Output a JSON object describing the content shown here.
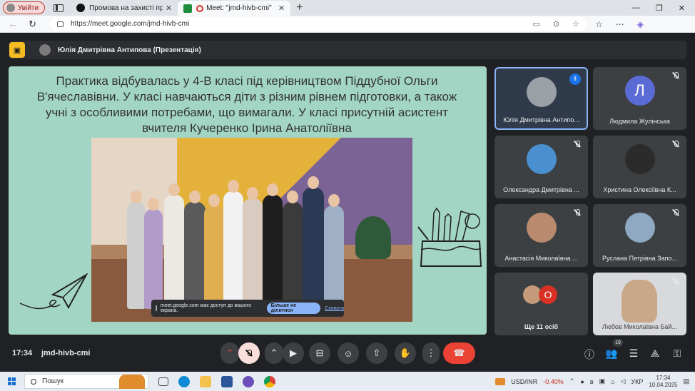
{
  "browser": {
    "profile_label": "Увійти",
    "tabs": [
      {
        "title": "Промова на захисті практики"
      },
      {
        "title": "Meet: \"jmd-hivb-cmi\""
      }
    ],
    "url": "https://meet.google.com/jmd-hivb-cmi"
  },
  "presenter": {
    "label": "Юлія Дмитрівна Антипова (Презентація)"
  },
  "slide": {
    "text": "Практика відбувалась у 4-В класі під керівництвом Піддубної Ольги В'ячеславівни. У класі навчаються діти з різним рівнем підготовки, а також учні з особливими потребами, що вимагали. У класі присутній асистент вчителя Кучеренко Ірина Анатоліївна"
  },
  "share_banner": {
    "text": "meet.google.com має доступ до вашого екрана.",
    "stop_label": "Більше не ділитися",
    "hide_label": "Сховати"
  },
  "participants": [
    {
      "name": "Юлія Дмитрівна Антипо...",
      "avatar_color": "#9aa0a6"
    },
    {
      "name": "Людмила Жулінська",
      "initial": "Л",
      "avatar_color": "#5b6bd5"
    },
    {
      "name": "Олександра Дмитрівна ...",
      "avatar_color": "#4a8fd0"
    },
    {
      "name": "Христина Олексіївна К...",
      "avatar_color": "#2b2b2b"
    },
    {
      "name": "Анастасія Миколаївна ...",
      "avatar_color": "#b98a6e"
    },
    {
      "name": "Руслана Петрівна Запо...",
      "avatar_color": "#8fa9c2"
    },
    {
      "name": "Ще 11 осіб",
      "initial": "О",
      "avatar_color": "#d93025"
    },
    {
      "name": "Любов Миколаївна Бай..."
    }
  ],
  "controls": {
    "time": "17:34",
    "meeting_code": "jmd-hivb-cmi",
    "people_count": "19"
  },
  "taskbar": {
    "search_label": "Пошук",
    "ticker_label": "USD/INR",
    "ticker_change": "-0.40%",
    "language": "УКР",
    "time": "17:34",
    "date": "10.04.2025"
  }
}
